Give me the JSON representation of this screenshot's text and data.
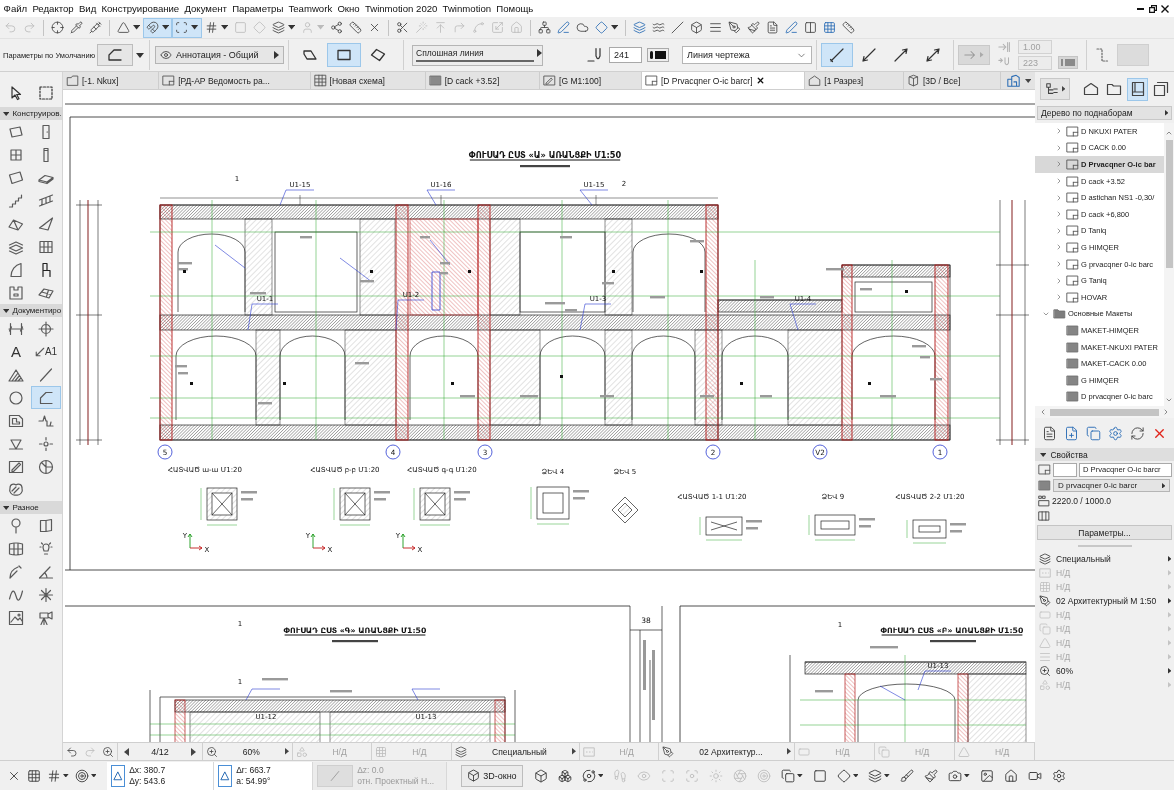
{
  "window": {
    "menu": [
      "Файл",
      "Редактор",
      "Вид",
      "Конструирование",
      "Документ",
      "Параметры",
      "Teamwork",
      "Окно",
      "Twinmotion 2020",
      "Twinmotion",
      "Помощь"
    ]
  },
  "toolbar": [
    {
      "selected": false,
      "disabled": true,
      "menu": false
    },
    {
      "selected": false,
      "disabled": true,
      "menu": false
    },
    {
      "selected": false,
      "disabled": false,
      "menu": false
    },
    {
      "selected": false,
      "disabled": false,
      "menu": false
    },
    {
      "selected": false,
      "disabled": false,
      "menu": false
    },
    {
      "selected": false,
      "disabled": false,
      "menu": true
    },
    {
      "selected": true,
      "disabled": false,
      "menu": true
    },
    {
      "selected": true,
      "disabled": false,
      "menu": true
    },
    {
      "selected": false,
      "disabled": false,
      "menu": true
    },
    {
      "selected": false,
      "disabled": true,
      "menu": false
    },
    {
      "selected": false,
      "disabled": true,
      "menu": false
    },
    {
      "selected": false,
      "disabled": false,
      "menu": true
    },
    {
      "selected": false,
      "disabled": true,
      "menu": true
    },
    {
      "selected": false,
      "disabled": false,
      "menu": false
    },
    {
      "selected": false,
      "disabled": false,
      "menu": false
    },
    {
      "selected": false,
      "disabled": false,
      "menu": false
    },
    {
      "selected": false,
      "disabled": false,
      "menu": false
    },
    {
      "selected": false,
      "disabled": true,
      "menu": false
    },
    {
      "selected": false,
      "disabled": true,
      "menu": false
    },
    {
      "selected": false,
      "disabled": true,
      "menu": false
    },
    {
      "selected": false,
      "disabled": true,
      "menu": false
    },
    {
      "selected": false,
      "disabled": true,
      "menu": false
    },
    {
      "selected": false,
      "disabled": true,
      "menu": false
    },
    {
      "selected": false,
      "disabled": false,
      "menu": false
    },
    {
      "selected": false,
      "disabled": false,
      "menu": false
    },
    {
      "selected": false,
      "disabled": false,
      "menu": false
    },
    {
      "selected": false,
      "disabled": false,
      "menu": true
    },
    {
      "selected": false,
      "disabled": false,
      "menu": false
    },
    {
      "selected": false,
      "disabled": false,
      "menu": false
    },
    {
      "selected": false,
      "disabled": false,
      "menu": false
    },
    {
      "selected": false,
      "disabled": false,
      "menu": false
    },
    {
      "selected": false,
      "disabled": false,
      "menu": false
    },
    {
      "selected": false,
      "disabled": false,
      "menu": false
    },
    {
      "selected": false,
      "disabled": false,
      "menu": false
    },
    {
      "selected": false,
      "disabled": false,
      "menu": false
    },
    {
      "selected": false,
      "disabled": false,
      "menu": false
    },
    {
      "selected": false,
      "disabled": false,
      "menu": false
    },
    {
      "selected": false,
      "disabled": false,
      "menu": false
    },
    {
      "selected": false,
      "disabled": false,
      "menu": false
    }
  ],
  "info_box": {
    "title": "Параметры по Умолчанию",
    "layer": "Аннотация - Общий",
    "geometry": [
      {
        "selected": false
      },
      {
        "selected": true
      },
      {
        "selected": false
      }
    ],
    "line_type": "Сплошная линия",
    "pen": "241",
    "line_category": "Линия чертежа",
    "arrows": [
      {
        "selected": true
      },
      {
        "selected": false
      },
      {
        "selected": false
      },
      {
        "selected": false
      }
    ],
    "arrow_settings": {
      "disabled": true,
      "size": "1.00",
      "pen": "223"
    }
  },
  "tabs": [
    {
      "label": "[-1. Nkux]",
      "kind": "plan",
      "selected": false
    },
    {
      "label": "[РД-АР Ведомость ра...",
      "kind": "layout",
      "selected": false
    },
    {
      "label": "[Новая схема]",
      "kind": "schedule",
      "selected": false
    },
    {
      "label": "[D cack +3.52]",
      "kind": "worksheet",
      "selected": false
    },
    {
      "label": "[G M1:100]",
      "kind": "drawing",
      "selected": false
    },
    {
      "label": "[D Prvacqner O-ic barcr]",
      "kind": "layout",
      "selected": true
    },
    {
      "label": "[1 Разрез]",
      "kind": "section",
      "selected": false
    },
    {
      "label": "[3D / Все]",
      "kind": "model",
      "selected": false
    }
  ],
  "toolbox": {
    "selection_tools": [
      {
        "selected": false
      },
      {
        "selected": false
      }
    ],
    "sections": [
      {
        "title": "Конструиров.",
        "expanded": true,
        "tools": [
          {
            "selected": false
          },
          {
            "selected": false
          },
          {
            "selected": false
          },
          {
            "selected": false
          },
          {
            "selected": false
          },
          {
            "selected": false
          },
          {
            "selected": false
          },
          {
            "selected": false
          },
          {
            "selected": false
          },
          {
            "selected": false
          },
          {
            "selected": false
          },
          {
            "selected": false
          },
          {
            "selected": false
          },
          {
            "selected": false
          },
          {
            "selected": false
          },
          {
            "selected": false
          }
        ]
      },
      {
        "title": "Документиро",
        "expanded": true,
        "tools": [
          {
            "selected": false
          },
          {
            "selected": false
          },
          {
            "selected": false,
            "glyph": "A"
          },
          {
            "selected": false,
            "glyph": "A1"
          },
          {
            "selected": false
          },
          {
            "selected": false
          },
          {
            "selected": false
          },
          {
            "selected": true
          },
          {
            "selected": false
          },
          {
            "selected": false
          },
          {
            "selected": false
          },
          {
            "selected": false
          },
          {
            "selected": false
          },
          {
            "selected": false
          },
          {
            "selected": false
          }
        ]
      },
      {
        "title": "Разное",
        "expanded": true,
        "tools": [
          {
            "selected": false
          },
          {
            "selected": false
          },
          {
            "selected": false
          },
          {
            "selected": false
          },
          {
            "selected": false
          },
          {
            "selected": false
          },
          {
            "selected": false
          },
          {
            "selected": false
          },
          {
            "selected": false
          },
          {
            "selected": false
          }
        ]
      }
    ]
  },
  "drawing": {
    "sheets": [
      {
        "title": "ՓՈՒՍԱԴ ԸՍՏ «Ա» ԱՌԱՆՑՔԻ Մ1:50",
        "tags": [
          "1",
          "Ս1-15",
          "Ս1-16",
          "Ս1-15",
          "2",
          "Ս1-1",
          "Ս1-2",
          "Ս1-3",
          "Ս1-4"
        ],
        "axes": [
          "5",
          "4",
          "3",
          "2",
          "V2",
          "1"
        ],
        "details": [
          {
            "title": "ՀԱՏՎԱԾ ա-ա Մ1:20",
            "axis_letters": [
              "Y",
              "X"
            ]
          },
          {
            "title": "ՀԱՏՎԱԾ բ-բ Մ1:20",
            "axis_letters": [
              "Y",
              "X"
            ]
          },
          {
            "title": "ՀԱՏՎԱԾ գ-գ Մ1:20",
            "axis_letters": [
              "Y",
              "X"
            ]
          },
          {
            "title": "ՁԵՎ 4"
          },
          {
            "title": "ՁԵՎ 5"
          },
          {
            "title": "ՀԱՏՎԱԾ 1-1 Մ1:20"
          },
          {
            "title": "ՁԵՎ 9"
          },
          {
            "title": "ՀԱՏՎԱԾ 2-2 Մ1:20"
          }
        ]
      },
      {
        "title": "ՓՈՒՍԱԴ ԸՍՏ «Գ» ԱՌԱՆՑՔԻ Մ1:50",
        "tags": [
          "1",
          "1",
          "Ս1-12",
          "Ս1-13"
        ]
      },
      {
        "title": "ՓՈՒՍԱԴ ԸՍՏ «Բ» ԱՌԱՆՑՔԻ Մ1:50",
        "tags": [
          "1",
          "Ս1-13"
        ]
      }
    ],
    "sheet_number": "38"
  },
  "navigator": {
    "view_buttons": [
      {
        "selected": false
      },
      {
        "selected": false
      },
      {
        "selected": true
      },
      {
        "selected": false
      }
    ],
    "mode": "Дерево по поднаборам",
    "tree": {
      "continued_children": [
        {
          "label": "D NKUXI PATER",
          "kind": "layout",
          "expanded": false,
          "selected": false
        },
        {
          "label": "D CACK 0.00",
          "kind": "layout",
          "expanded": false,
          "selected": false
        },
        {
          "label": "D Prvacqner O-ic bar",
          "kind": "layout",
          "expanded": false,
          "selected": true
        },
        {
          "label": "D cack +3.52",
          "kind": "layout",
          "expanded": false,
          "selected": false
        },
        {
          "label": "D astichan NS1 -0,30/",
          "kind": "layout",
          "expanded": false,
          "selected": false
        },
        {
          "label": "D cack +6,800",
          "kind": "layout",
          "expanded": false,
          "selected": false
        },
        {
          "label": "D Taniq",
          "kind": "layout",
          "expanded": false,
          "selected": false
        },
        {
          "label": "G HIMQER",
          "kind": "layout",
          "expanded": false,
          "selected": false
        },
        {
          "label": "G prvacqner 0-ic barc",
          "kind": "layout",
          "expanded": false,
          "selected": false
        },
        {
          "label": "G Taniq",
          "kind": "layout",
          "expanded": false,
          "selected": false
        },
        {
          "label": "HOVAR",
          "kind": "layout",
          "expanded": false,
          "selected": false
        }
      ],
      "items": [
        {
          "label": "Основные Макеты",
          "kind": "folder",
          "expanded": true,
          "selected": false,
          "children": [
            {
              "label": "MAKET-HIMQER",
              "kind": "master",
              "selected": false
            },
            {
              "label": "MAKET-NKUXI PATER",
              "kind": "master",
              "selected": false
            },
            {
              "label": "MAKET-CACK 0.00",
              "kind": "master",
              "selected": false
            },
            {
              "label": "G HIMQER",
              "kind": "master",
              "selected": false
            },
            {
              "label": "D prvacqner 0-ic barc",
              "kind": "master",
              "selected": false
            }
          ]
        }
      ]
    }
  },
  "properties": {
    "title": "Свойства",
    "expanded": true,
    "name": "D Prvacqner O-ic barcr",
    "master": "D prvacqner 0-ic barcr",
    "size": "2220.0 / 1000.0",
    "button": "Параметры..."
  },
  "view_settings": [
    {
      "label": "Специальный",
      "disabled": false
    },
    {
      "label": "Н/Д",
      "disabled": true
    },
    {
      "label": "Н/Д",
      "disabled": true
    },
    {
      "label": "02 Архитектурный М 1:50",
      "disabled": false
    },
    {
      "label": "Н/Д",
      "disabled": true
    },
    {
      "label": "Н/Д",
      "disabled": true
    },
    {
      "label": "Н/Д",
      "disabled": true
    },
    {
      "label": "Н/Д",
      "disabled": true
    },
    {
      "label": "60%",
      "disabled": false
    },
    {
      "label": "Н/Д",
      "disabled": true
    }
  ],
  "status_bar": {
    "history": [
      {
        "disabled": false
      },
      {
        "disabled": true
      }
    ],
    "page": "4/12",
    "options": [
      {
        "label": "60%",
        "disabled": false,
        "menu": true
      },
      {
        "label": "Н/Д",
        "disabled": true,
        "menu": false
      },
      {
        "label": "Н/Д",
        "disabled": true,
        "menu": false
      },
      {
        "label": "Специальный",
        "disabled": false,
        "menu": true
      },
      {
        "label": "Н/Д",
        "disabled": true,
        "menu": false
      },
      {
        "label": "02 Архитектур...",
        "disabled": false,
        "menu": true
      },
      {
        "label": "Н/Д",
        "disabled": true,
        "menu": false
      },
      {
        "label": "Н/Д",
        "disabled": true,
        "menu": false
      },
      {
        "label": "Н/Д",
        "disabled": true,
        "menu": false
      }
    ]
  },
  "bottom_toolbar": {
    "left_tools": [
      {
        "menu": false
      },
      {
        "menu": false
      },
      {
        "menu": true
      },
      {
        "menu": true
      }
    ],
    "coordinates": [
      {
        "lines": [
          "Δx: 380.7",
          "Δy: 543.6"
        ],
        "disabled": false
      },
      {
        "lines": [
          "Δr: 663.7",
          "a: 54.99°"
        ],
        "disabled": false
      },
      {
        "lines": [
          "Δz: 0.0",
          "отн. Проектный Н..."
        ],
        "disabled": true
      }
    ],
    "window_button": "3D-окно",
    "tools": [
      {
        "disabled": false,
        "menu": false
      },
      {
        "disabled": false,
        "menu": false
      },
      {
        "disabled": false,
        "menu": true
      },
      {
        "disabled": true,
        "menu": false
      },
      {
        "disabled": true,
        "menu": false
      },
      {
        "disabled": true,
        "menu": false
      },
      {
        "disabled": true,
        "menu": false
      },
      {
        "disabled": true,
        "menu": false
      },
      {
        "disabled": true,
        "menu": false
      },
      {
        "disabled": true,
        "menu": false
      },
      {
        "disabled": false,
        "menu": true
      },
      {
        "disabled": false,
        "menu": false
      },
      {
        "disabled": false,
        "menu": true
      },
      {
        "disabled": false,
        "menu": true
      },
      {
        "disabled": false,
        "menu": false
      },
      {
        "disabled": false,
        "menu": false
      },
      {
        "disabled": false,
        "menu": true
      },
      {
        "disabled": false,
        "menu": false
      },
      {
        "disabled": false,
        "menu": false
      },
      {
        "disabled": false,
        "menu": false
      },
      {
        "disabled": false,
        "menu": false
      }
    ]
  }
}
